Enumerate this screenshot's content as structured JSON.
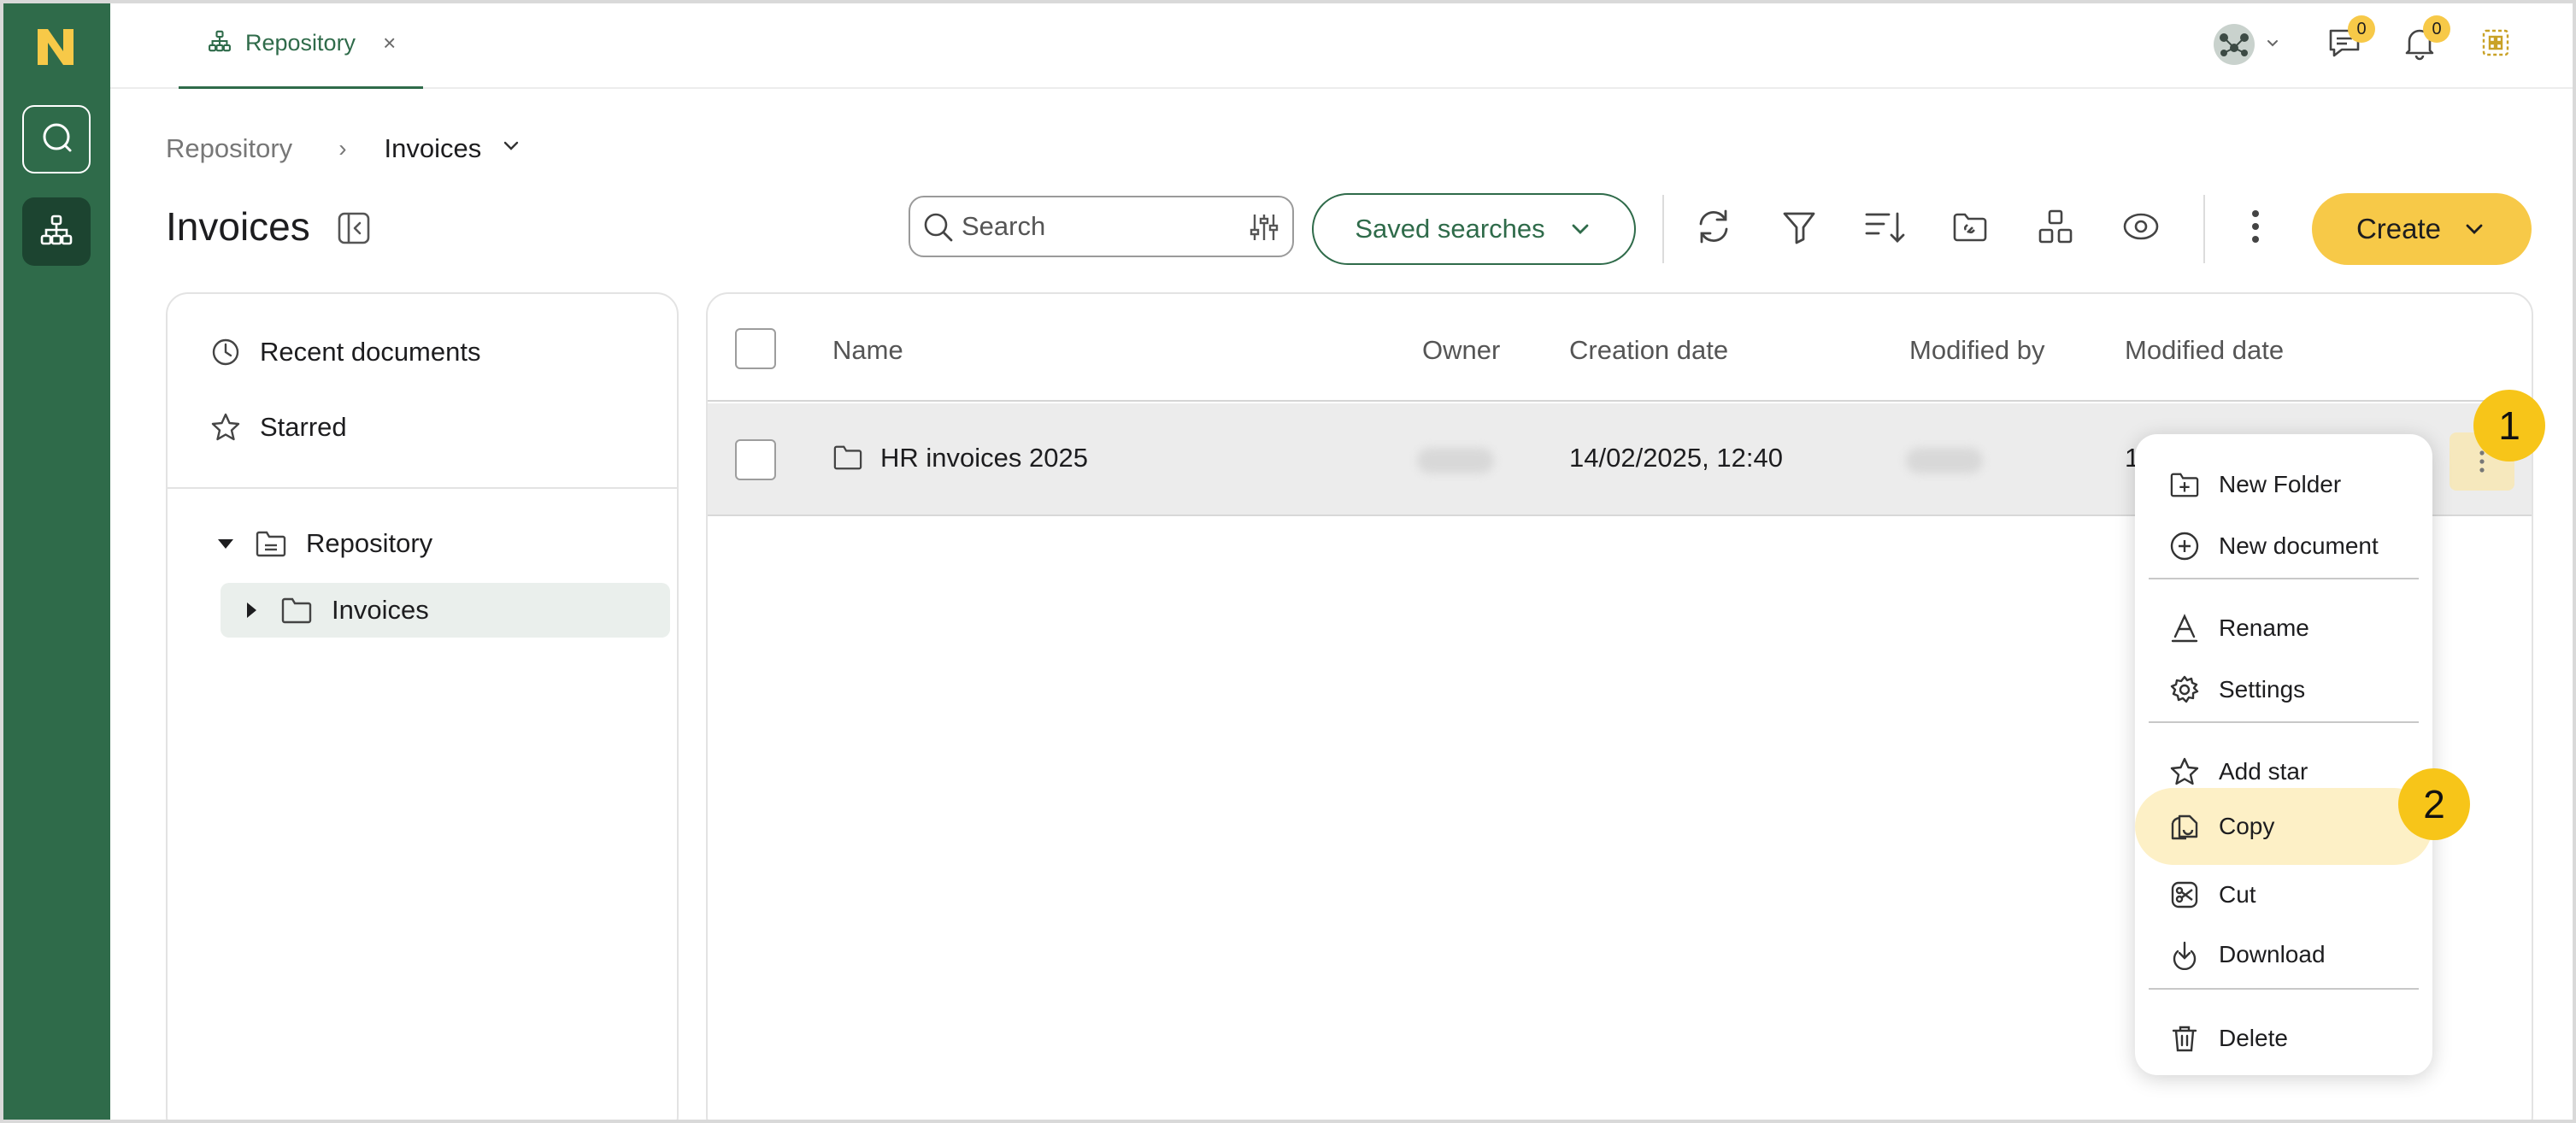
{
  "rail": {
    "logo_letter": "N",
    "items": [
      {
        "name": "search",
        "icon": "search-icon"
      },
      {
        "name": "repository",
        "icon": "sitemap-icon"
      }
    ]
  },
  "topbar": {
    "tab_label": "Repository",
    "tab_close": "×",
    "messages_count": "0",
    "notifications_count": "0"
  },
  "breadcrumb": {
    "root": "Repository",
    "separator": "›",
    "current": "Invoices"
  },
  "page_title": "Invoices",
  "toolbar": {
    "search_placeholder": "Search",
    "saved_searches_label": "Saved searches",
    "create_label": "Create",
    "icons": [
      "refresh-icon",
      "filter-icon",
      "sort-icon",
      "link-folder-icon",
      "view-layout-icon",
      "preview-eye-icon",
      "more-vertical-icon"
    ]
  },
  "sidebar": {
    "quick_links": [
      {
        "label": "Recent documents",
        "icon": "clock-icon"
      },
      {
        "label": "Starred",
        "icon": "star-icon"
      }
    ],
    "tree": [
      {
        "label": "Repository",
        "expanded": true,
        "icon": "repository-folder-icon"
      },
      {
        "label": "Invoices",
        "expanded": false,
        "selected": true,
        "icon": "folder-icon"
      }
    ]
  },
  "table": {
    "columns": [
      "Name",
      "Owner",
      "Creation date",
      "Modified by",
      "Modified date"
    ],
    "rows": [
      {
        "name": "HR invoices 2025",
        "owner": "",
        "creation_date": "14/02/2025, 12:40",
        "modified_by": "",
        "modified_date_visible": "1"
      }
    ]
  },
  "context_menu": {
    "items": [
      {
        "label": "New Folder",
        "icon": "new-folder-icon"
      },
      {
        "label": "New document",
        "icon": "new-document-icon"
      },
      {
        "label": "Rename",
        "icon": "rename-icon"
      },
      {
        "label": "Settings",
        "icon": "gear-icon"
      },
      {
        "label": "Add star",
        "icon": "star-icon"
      },
      {
        "label": "Copy",
        "icon": "copy-icon",
        "highlighted": true
      },
      {
        "label": "Cut",
        "icon": "scissors-icon"
      },
      {
        "label": "Download",
        "icon": "download-icon"
      },
      {
        "label": "Delete",
        "icon": "trash-icon"
      }
    ]
  },
  "callouts": {
    "step1": "1",
    "step2": "2"
  },
  "colors": {
    "brand_green": "#2f6b4a",
    "accent_yellow": "#f7c948",
    "highlight": "#fdf0c6"
  }
}
